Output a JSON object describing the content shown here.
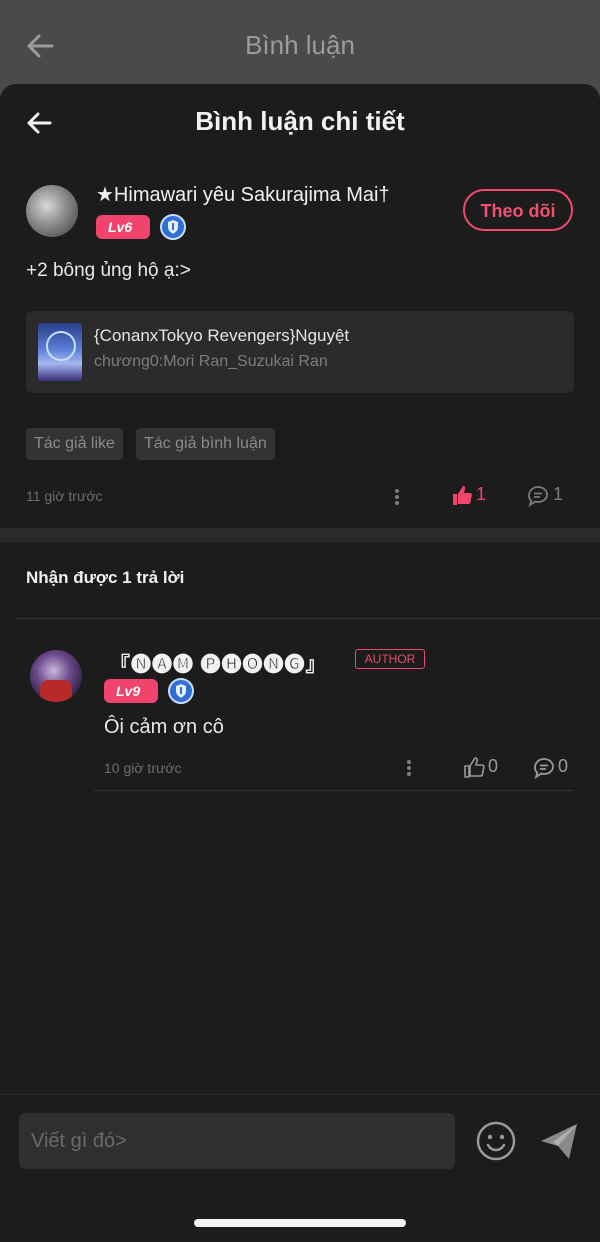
{
  "background": {
    "title": "Bình luận"
  },
  "sheet": {
    "title": "Bình luận chi tiết"
  },
  "comment": {
    "username": "★Himawari yêu Sakurajima Mai†",
    "level": "Lv6",
    "follow_label": "Theo dõi",
    "text": "+2 bông ủng hộ ạ:>",
    "book": {
      "title": "{ConanxTokyo Revengers}Nguyệt",
      "subtitle": "chương0:Mori Ran_Suzukai Ran"
    },
    "tags": [
      "Tác giả like",
      "Tác giả bình luận"
    ],
    "time": "11 giờ trước",
    "likes": "1",
    "replies": "1"
  },
  "replies_section": {
    "title": "Nhận được 1 trả lời"
  },
  "reply": {
    "username": "『🅝🅐🅜 🅟🅗🅞🅝🅖』",
    "author_badge": "AUTHOR",
    "level": "Lv9",
    "text": "Ôi cảm ơn cô",
    "time": "10 giờ trước",
    "likes": "0",
    "replies": "0"
  },
  "composer": {
    "placeholder": "Viết gì đó>"
  },
  "colors": {
    "accent": "#f0446c",
    "sheet_bg": "#1c1c1c",
    "overlay_bg": "#4a4a4a"
  },
  "icons": [
    "back-arrow-icon",
    "shield-badge-icon",
    "more-icon",
    "thumbs-up-icon",
    "comment-icon",
    "emoji-icon",
    "send-icon"
  ]
}
